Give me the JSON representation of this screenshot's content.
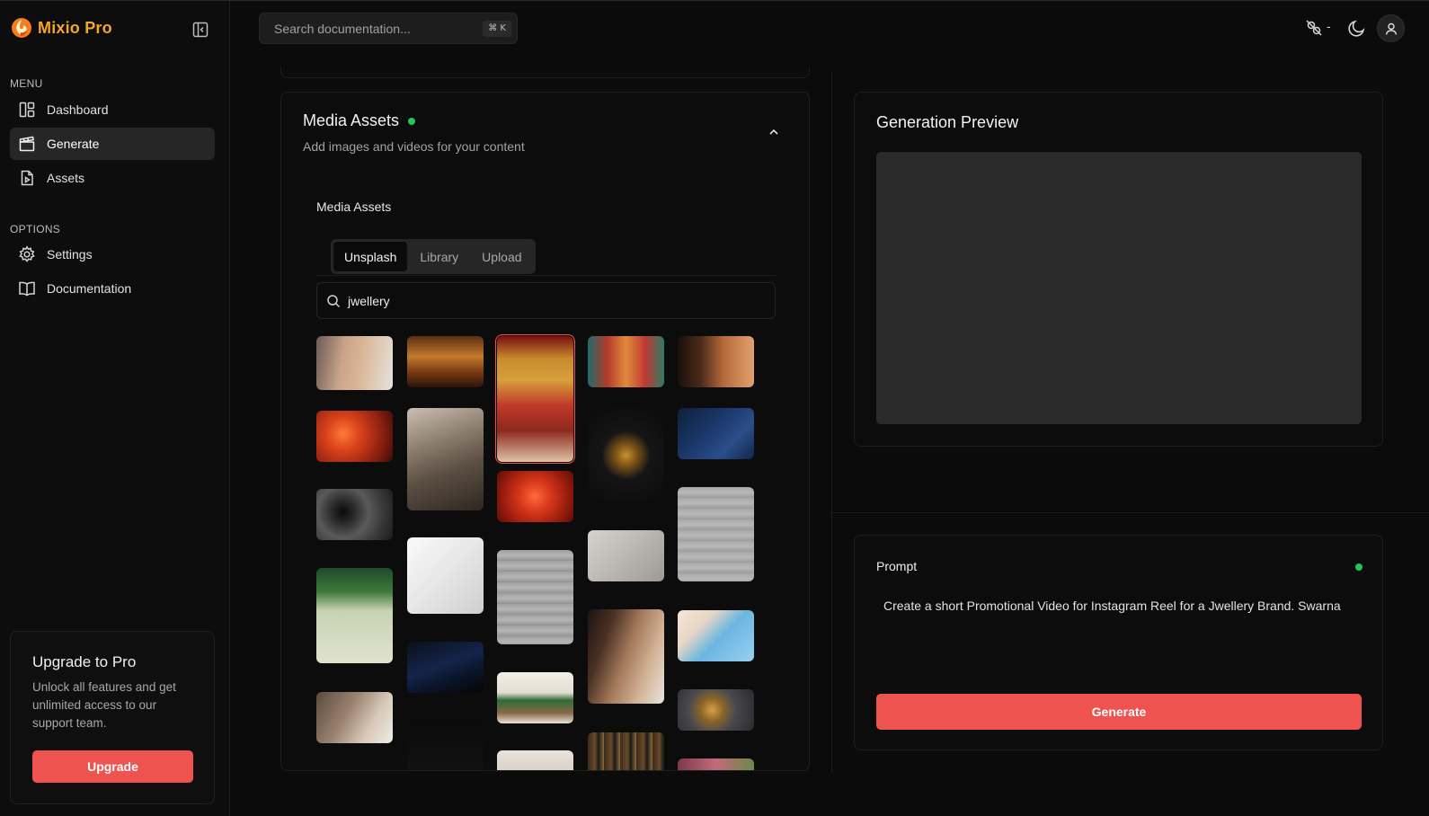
{
  "app": {
    "name": "Mixio Pro"
  },
  "header": {
    "search_placeholder": "Search documentation...",
    "search_shortcut": "⌘ K",
    "status_text": "-"
  },
  "sidebar": {
    "menu_title": "MENU",
    "menu_items": [
      {
        "label": "Dashboard",
        "icon": "dashboard-icon",
        "active": false
      },
      {
        "label": "Generate",
        "icon": "clapperboard-icon",
        "active": true
      },
      {
        "label": "Assets",
        "icon": "file-play-icon",
        "active": false
      }
    ],
    "options_title": "OPTIONS",
    "option_items": [
      {
        "label": "Settings",
        "icon": "gear-icon"
      },
      {
        "label": "Documentation",
        "icon": "book-icon"
      }
    ],
    "upgrade": {
      "title": "Upgrade to Pro",
      "description": "Unlock all features and get unlimited access to our support team.",
      "button": "Upgrade"
    }
  },
  "media_assets": {
    "title": "Media Assets",
    "subtitle": "Add images and videos for your content",
    "section_label": "Media Assets",
    "tabs": [
      {
        "label": "Unsplash",
        "active": true
      },
      {
        "label": "Library",
        "active": false
      },
      {
        "label": "Upload",
        "active": false
      }
    ],
    "search_value": "jwellery",
    "thumbnails": [
      {
        "subject": "woman-with-earrings",
        "selected": false
      },
      {
        "subject": "jewellery-shop-interior",
        "selected": false
      },
      {
        "subject": "bride-gold-necklace",
        "selected": true
      },
      {
        "subject": "bangles-market",
        "selected": false
      },
      {
        "subject": "bride-profile",
        "selected": false
      },
      {
        "subject": "ring-on-red-silk",
        "selected": false
      },
      {
        "subject": "antique-shop",
        "selected": false
      },
      {
        "subject": "gold-earrings-dark",
        "selected": false
      },
      {
        "subject": "earrings-blue-card",
        "selected": false
      },
      {
        "subject": "black-ring",
        "selected": false
      },
      {
        "subject": "ring-on-red-fabric",
        "selected": false
      },
      {
        "subject": "gold-pendant-grey",
        "selected": false
      },
      {
        "subject": "gold-chain-grey",
        "selected": false
      },
      {
        "subject": "ring-white-box",
        "selected": false
      },
      {
        "subject": "necklace-on-leaf",
        "selected": false
      },
      {
        "subject": "gold-chain-stone",
        "selected": false
      },
      {
        "subject": "woman-green-earring",
        "selected": false
      },
      {
        "subject": "ring-blue-tube",
        "selected": false
      },
      {
        "subject": "earrings-blue-stand",
        "selected": false
      },
      {
        "subject": "ring-on-wood-leaf",
        "selected": false
      },
      {
        "subject": "hand-with-ring",
        "selected": false
      },
      {
        "subject": "gold-ring-dark",
        "selected": false
      },
      {
        "subject": "dark-image",
        "selected": false
      },
      {
        "subject": "shelf-display",
        "selected": false
      },
      {
        "subject": "light-image",
        "selected": false
      },
      {
        "subject": "pink-image",
        "selected": false
      }
    ]
  },
  "preview": {
    "title": "Generation Preview"
  },
  "prompt": {
    "label": "Prompt",
    "text": "Create a short Promotional Video for Instagram Reel for a Jwellery Brand. Swarna",
    "button": "Generate"
  },
  "colors": {
    "accent": "#ef5350",
    "brand": "#f5a623",
    "status_green": "#22c55e"
  }
}
